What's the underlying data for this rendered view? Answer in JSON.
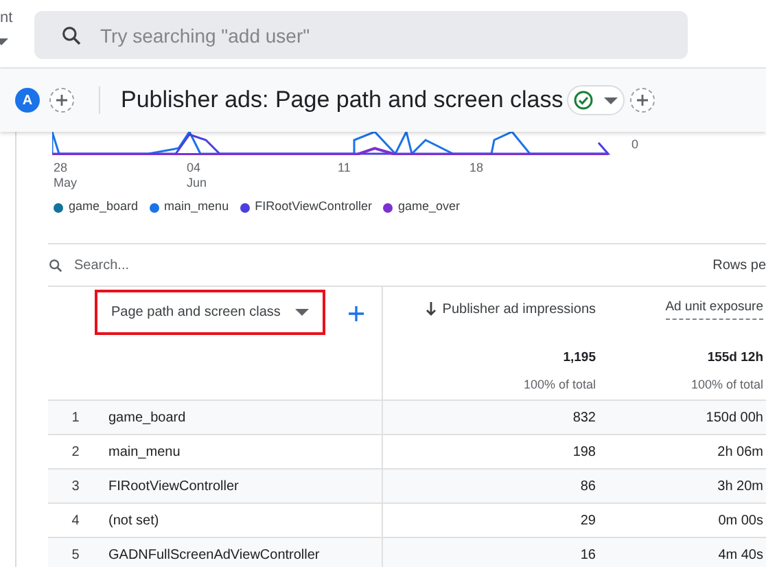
{
  "top_bar": {
    "left_label": "nt",
    "search": {
      "placeholder": "Try searching \"add user\""
    }
  },
  "header": {
    "avatar": "A",
    "title": "Publisher ads: Page path and screen class"
  },
  "chart": {
    "y_label": "0",
    "x_labels": [
      {
        "day": "28",
        "month": "May"
      },
      {
        "day": "04",
        "month": "Jun"
      },
      {
        "day": "11"
      },
      {
        "day": "18"
      }
    ],
    "legend": [
      {
        "label": "game_board",
        "color": "#12739b"
      },
      {
        "label": "main_menu",
        "color": "#1a73e8"
      },
      {
        "label": "FIRootViewController",
        "color": "#4b3fe0"
      },
      {
        "label": "game_over",
        "color": "#7b32d0"
      }
    ]
  },
  "table": {
    "search": {
      "placeholder": "Search..."
    },
    "rows_per_page": "Rows pe",
    "dimension": {
      "label": "Page path and screen class",
      "highlighted": true
    },
    "columns": [
      {
        "label": "Publisher ad impressions",
        "sorted": true,
        "total": "1,195",
        "share": "100% of total"
      },
      {
        "label": "Ad unit exposure",
        "sorted": false,
        "total": "155d 12h",
        "share": "100% of total"
      }
    ],
    "rows": [
      {
        "index": "1",
        "name": "game_board",
        "values": [
          "832",
          "150d 00h"
        ]
      },
      {
        "index": "2",
        "name": "main_menu",
        "values": [
          "198",
          "2h 06m"
        ]
      },
      {
        "index": "3",
        "name": "FIRootViewController",
        "values": [
          "86",
          "3h 20m"
        ]
      },
      {
        "index": "4",
        "name": "(not set)",
        "values": [
          "29",
          "0m 00s"
        ]
      },
      {
        "index": "5",
        "name": "GADNFullScreenAdViewController",
        "values": [
          "16",
          "4m 40s"
        ]
      }
    ]
  }
}
